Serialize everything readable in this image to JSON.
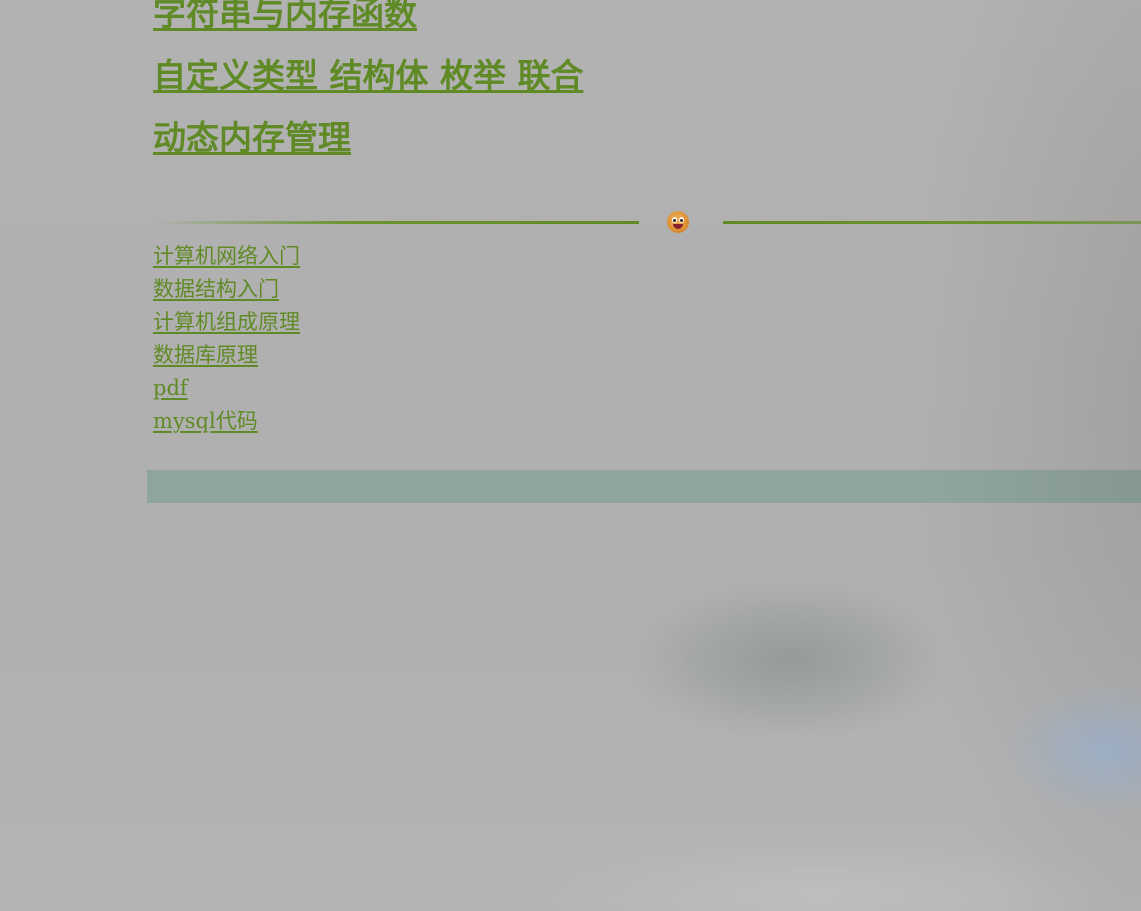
{
  "headings": [
    {
      "label": "字符串与内存函数"
    },
    {
      "label": "自定义类型 结构体 枚举 联合"
    },
    {
      "label": "动态内存管理"
    }
  ],
  "divider": {
    "icon": "grinning-face-emoji-icon"
  },
  "links": [
    {
      "label": "计算机网络入门"
    },
    {
      "label": "数据结构入门"
    },
    {
      "label": "计算机组成原理"
    },
    {
      "label": "数据库原理"
    },
    {
      "label": "pdf"
    },
    {
      "label": "mysql代码"
    }
  ],
  "colors": {
    "link": "#5f8a25",
    "background": "#b3b3b3",
    "bar": "#8ea49c"
  }
}
